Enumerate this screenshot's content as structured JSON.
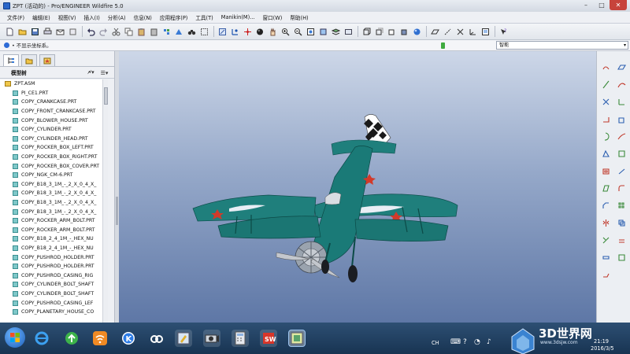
{
  "window": {
    "title": "ZPT (活动的) - Pro/ENGINEER Wildfire 5.0",
    "minimize": "–",
    "maximize": "□",
    "close": "✕"
  },
  "menu": [
    "文件(F)",
    "编辑(E)",
    "视图(V)",
    "插入(I)",
    "分析(A)",
    "信息(N)",
    "应用程序(P)",
    "工具(T)",
    "Manikin(M)...",
    "窗口(W)",
    "帮助(H)"
  ],
  "message": {
    "text": "• 不显示坐标系。",
    "filter_value": "智能",
    "filter_arrow": "▾"
  },
  "model_tree": {
    "header": "模型树",
    "tool_settings": "🗲▾",
    "tool_show": "☰▾",
    "root": "ZPT.ASM",
    "items": [
      "PI_CE1.PRT",
      "COPY_CRANKCASE.PRT",
      "COPY_FRONT_CRANKCASE.PRT",
      "COPY_BLOWER_HOUSE.PRT",
      "COPY_CYLINDER.PRT",
      "COPY_CYLINDER_HEAD.PRT",
      "COPY_ROCKER_BOX_LEFT.PRT",
      "COPY_ROCKER_BOX_RIGHT.PRT",
      "COPY_ROCKER_BOX_COVER.PRT",
      "COPY_NGK_CM-6.PRT",
      "COPY_B18_3_1M_-_2_X_0_4_X_",
      "COPY_B18_3_1M_-_2_X_0_4_X_",
      "COPY_B18_3_1M_-_2_X_0_4_X_",
      "COPY_B18_3_1M_-_2_X_0_4_X_",
      "COPY_ROCKER_ARM_BOLT.PRT",
      "COPY_ROCKER_ARM_BOLT.PRT",
      "COPY_B18_2_4_1M_-_HEX_NU",
      "COPY_B18_2_4_1M_-_HEX_NU",
      "COPY_PUSHROD_HOLDER.PRT",
      "COPY_PUSHROD_HOLDER.PRT",
      "COPY_PUSHROD_CASING_RIG",
      "COPY_CYLINDER_BOLT_SHAFT",
      "COPY_CYLINDER_BOLT_SHAFT",
      "COPY_PUSHROD_CASING_LEF",
      "COPY_PLANETARY_HOUSE_CO"
    ]
  },
  "tray": {
    "lang": "CH",
    "time": "21:19",
    "date": "2016/3/5"
  },
  "watermark": {
    "text": "3D世界网",
    "url": "www.3dsjw.com"
  },
  "colors": {
    "plane_body": "#1f7f7c",
    "plane_dark": "#145a57",
    "star": "#d23a2a",
    "viewport_top": "#cdd7e8",
    "viewport_bottom": "#5e77a6"
  }
}
